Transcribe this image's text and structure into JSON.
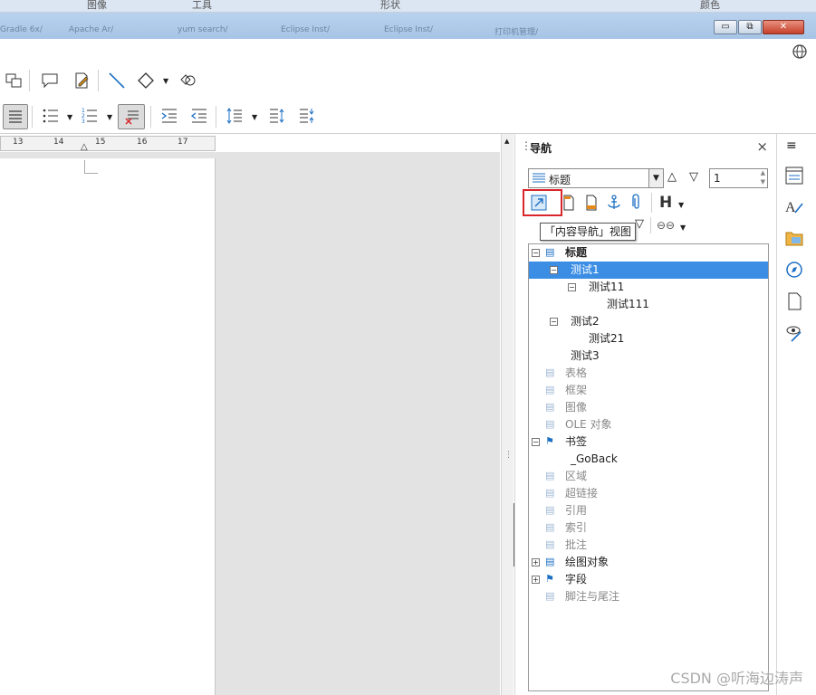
{
  "top_menu": {
    "image": "图像",
    "tools": "工具",
    "shape": "形状",
    "color": "颜色"
  },
  "taskbar": {
    "items": [
      "Gradle 6x/",
      "Apache Ar/",
      "yum search/",
      "Eclipse Inst/",
      "Eclipse Inst/",
      "打印机管理/"
    ]
  },
  "window": {
    "min": "▭",
    "restore": "⧉",
    "close": "✕"
  },
  "ruler": {
    "ticks": [
      "13",
      "14",
      "15",
      "16",
      "17"
    ]
  },
  "nav": {
    "title": "导航",
    "close_icon": "×",
    "menu_icon": "≡",
    "category_select": "标题",
    "level_value": "1",
    "tooltip": "「内容导航」视图",
    "heading_button": "H",
    "tree": [
      {
        "label": "标题",
        "level": 0,
        "expanded": true,
        "bold": true
      },
      {
        "label": "测试1",
        "level": 1,
        "expanded": true,
        "selected": true
      },
      {
        "label": "测试11",
        "level": 2,
        "expanded": true
      },
      {
        "label": "测试111",
        "level": 3
      },
      {
        "label": "测试2",
        "level": 1,
        "expanded": true
      },
      {
        "label": "测试21",
        "level": 2
      },
      {
        "label": "测试3",
        "level": 1
      },
      {
        "label": "表格",
        "level": 0,
        "disabled": true
      },
      {
        "label": "框架",
        "level": 0,
        "disabled": true
      },
      {
        "label": "图像",
        "level": 0,
        "disabled": true
      },
      {
        "label": "OLE 对象",
        "level": 0,
        "disabled": true
      },
      {
        "label": "书签",
        "level": 0,
        "expanded": true
      },
      {
        "label": "_GoBack",
        "level": 1
      },
      {
        "label": "区域",
        "level": 0,
        "disabled": true
      },
      {
        "label": "超链接",
        "level": 0,
        "disabled": true
      },
      {
        "label": "引用",
        "level": 0,
        "disabled": true
      },
      {
        "label": "索引",
        "level": 0,
        "disabled": true
      },
      {
        "label": "批注",
        "level": 0,
        "disabled": true
      },
      {
        "label": "绘图对象",
        "level": 0,
        "collapsed": true
      },
      {
        "label": "字段",
        "level": 0,
        "collapsed": true
      },
      {
        "label": "脚注与尾注",
        "level": 0,
        "disabled": true
      }
    ]
  },
  "watermark": "CSDN @听海边涛声",
  "colors": {
    "selection": "#3b8ee4",
    "highlight_box": "#d9262b",
    "accent": "#1c6fc4"
  }
}
